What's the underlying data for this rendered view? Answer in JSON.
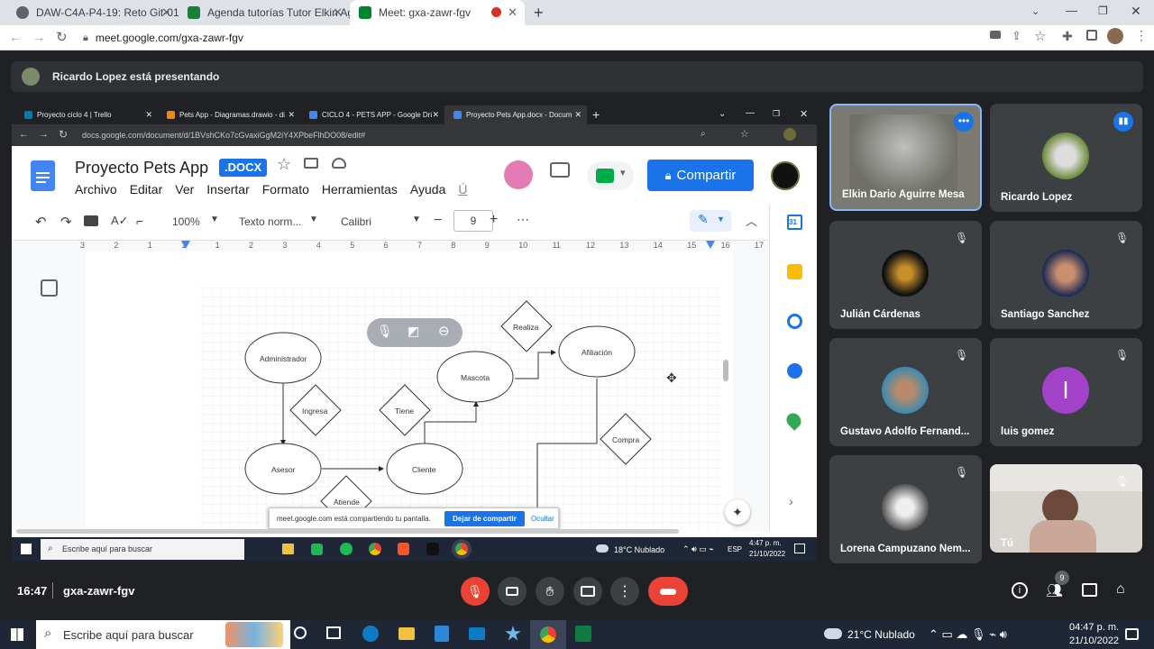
{
  "browser": {
    "tabs": [
      {
        "title": "DAW-C4A-P4-19: Reto Git-01",
        "favicon": "gear-favicon",
        "color": "#5f6368"
      },
      {
        "title": "Agenda tutorías Tutor Elkin Agui",
        "favicon": "sheets-favicon",
        "color": "#188038"
      },
      {
        "title": "Meet: gxa-zawr-fgv",
        "favicon": "meet-favicon",
        "color": "#00832d",
        "active": true
      }
    ],
    "url": "meet.google.com/gxa-zawr-fgv"
  },
  "presenting": {
    "text": "Ricardo Lopez está presentando"
  },
  "shared": {
    "tabs": [
      {
        "title": "Proyecto ciclo 4 | Trello",
        "color": "#0079bf"
      },
      {
        "title": "Pets App - Diagramas.drawio - di",
        "color": "#f08705"
      },
      {
        "title": "CICLO 4 - PETS APP - Google Dri",
        "color": "#4285f4"
      },
      {
        "title": "Proyecto Pets App.docx - Docum",
        "color": "#4285f4",
        "active": true
      }
    ],
    "url": "docs.google.com/document/d/1BVshCKo7cGvaxiGgM2iY4XPbeFlhDO08/edit#",
    "doc_title": "Proyecto Pets App",
    "doc_badge": ".DOCX",
    "menu": [
      "Archivo",
      "Editar",
      "Ver",
      "Insertar",
      "Formato",
      "Herramientas",
      "Ayuda",
      "Ú"
    ],
    "share_label": "Compartir",
    "zoom": "100%",
    "style": "Texto norm...",
    "font": "Calibri",
    "font_size": "9",
    "ruler": [
      "3",
      "2",
      "1",
      "1",
      "1",
      "2",
      "3",
      "4",
      "5",
      "6",
      "7",
      "8",
      "9",
      "10",
      "11",
      "12",
      "13",
      "14",
      "15",
      "16",
      "17"
    ],
    "diagram": {
      "entities": [
        "Administrador",
        "Asesor",
        "Cliente",
        "Mascota",
        "Afiliación"
      ],
      "relations": [
        "Ingresa",
        "Tiene",
        "Realiza",
        "Compra",
        "Atiende"
      ]
    },
    "share_bar": {
      "text": "meet.google.com está compartiendo tu pantalla.",
      "stop": "Dejar de compartir",
      "hide": "Ocultar"
    },
    "taskbar": {
      "search": "Escribe aquí para buscar",
      "weather": "18°C  Nublado",
      "lang": "ESP",
      "time": "4:47 p. m.",
      "date": "21/10/2022"
    }
  },
  "participants": [
    {
      "name": "Elkin Dario Aguirre Mesa",
      "muted": false,
      "video": true,
      "active": true
    },
    {
      "name": "Ricardo Lopez",
      "muted": false,
      "speaking": true
    },
    {
      "name": "Julián Cárdenas",
      "muted": true
    },
    {
      "name": "Santiago Sanchez",
      "muted": true
    },
    {
      "name": "Gustavo Adolfo Fernand...",
      "muted": true
    },
    {
      "name": "luis gomez",
      "muted": true,
      "initial": "l",
      "color": "#a142c9"
    },
    {
      "name": "Lorena Campuzano Nem...",
      "muted": true
    },
    {
      "name": "Tú",
      "muted": true,
      "video": true
    }
  ],
  "meeting": {
    "time": "16:47",
    "code": "gxa-zawr-fgv",
    "people_count": "9"
  },
  "windows": {
    "search": "Escribe aquí para buscar",
    "weather": "21°C  Nublado",
    "time": "04:47 p. m.",
    "date": "21/10/2022"
  }
}
